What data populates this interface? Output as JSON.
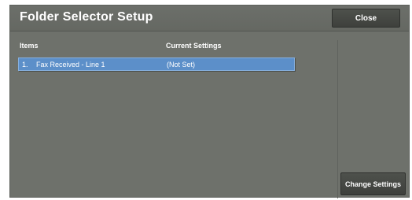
{
  "header": {
    "title": "Folder Selector Setup",
    "close_label": "Close"
  },
  "table": {
    "columns": [
      "Items",
      "Current Settings"
    ],
    "rows": [
      {
        "number": "1.",
        "item": "Fax Received - Line 1",
        "current_setting": "(Not Set)"
      }
    ]
  },
  "actions": {
    "change_settings_label": "Change Settings"
  }
}
